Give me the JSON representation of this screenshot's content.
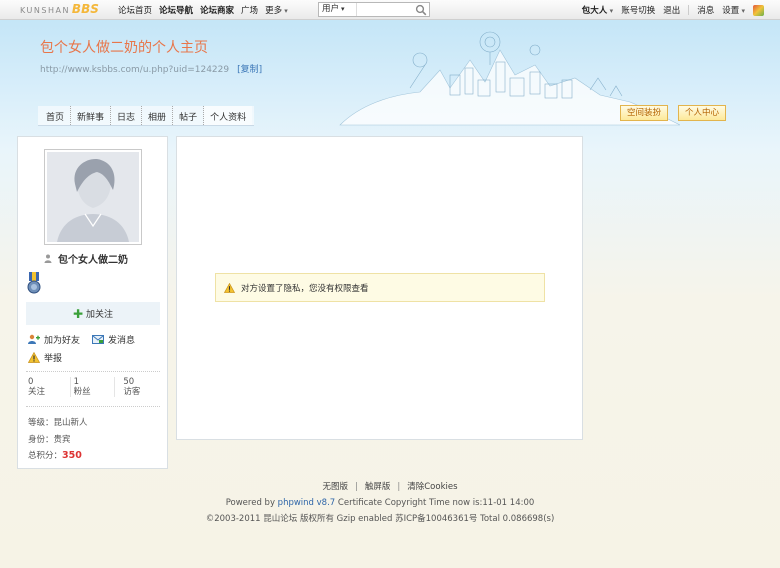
{
  "topbar": {
    "logo_prefix": "KUNSHAN",
    "logo_bbs": "BBS",
    "nav": [
      "论坛首页",
      "论坛导航",
      "论坛商家",
      "广场",
      "更多"
    ],
    "search_type": "用户",
    "search_placeholder": "",
    "username": "包大人",
    "links": [
      "账号切换",
      "退出",
      "消息",
      "设置"
    ]
  },
  "header": {
    "title": "包个女人做二奶的个人主页",
    "url": "http://www.ksbbs.com/u.php?uid=124229",
    "copy_label": "[复制]",
    "tabs": [
      "首页",
      "新鲜事",
      "日志",
      "相册",
      "帖子",
      "个人资料"
    ],
    "btn_decorate": "空间装扮",
    "btn_center": "个人中心"
  },
  "sidebar": {
    "username": "包个女人做二奶",
    "follow_label": "加关注",
    "actions": {
      "add_friend": "加为好友",
      "send_msg": "发消息",
      "report": "举报"
    },
    "stats": [
      {
        "value": "0",
        "label": "关注"
      },
      {
        "value": "1",
        "label": "粉丝"
      },
      {
        "value": "50",
        "label": "访客"
      }
    ],
    "level": "等级：昆山新人",
    "identity": "身份：贵宾",
    "points_label": "总积分：",
    "points_value": "350"
  },
  "main": {
    "notice": "对方设置了隐私，您没有权限查看"
  },
  "footer": {
    "links": [
      "无图版",
      "触屏版",
      "清除Cookies"
    ],
    "powered_prefix": "Powered by ",
    "powered_link": "phpwind v8.7",
    "powered_suffix": " Certificate Copyright Time now is:11-01 14:00",
    "copyright": "©2003-2011 昆山论坛 版权所有 Gzip enabled 苏ICP备10046361号 Total 0.086698(s)"
  },
  "colors": {
    "title": "#e8764a",
    "points": "#dd3333",
    "button_text": "#b36200"
  }
}
